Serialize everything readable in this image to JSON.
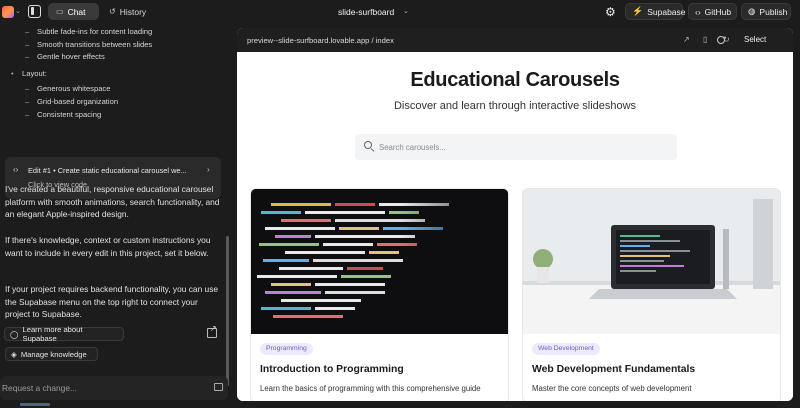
{
  "topbar": {
    "tabs": [
      {
        "label": "Chat",
        "active": true
      },
      {
        "label": "History",
        "active": false
      }
    ],
    "project_title": "slide-surfboard",
    "buttons": {
      "supabase": "Supabase",
      "github": "GitHub",
      "publish": "Publish"
    }
  },
  "chat": {
    "bullets": {
      "sub1": "Subtle fade-ins for content loading",
      "sub2": "Smooth transitions between slides",
      "sub3": "Gentle hover effects",
      "layout": "Layout:",
      "layout1": "Generous whitespace",
      "layout2": "Grid-based organization",
      "layout3": "Consistent spacing"
    },
    "edit_card": {
      "title": "Edit #1 • Create static educational carousel we...",
      "subtitle": "Click to view code"
    },
    "messages": [
      "I've created a beautiful, responsive educational carousel platform with smooth animations, search functionality, and an elegant Apple-inspired design.",
      "If there's knowledge, context or custom instructions you want to include in every edit in this project, set it below.",
      "If your project requires backend functionality, you can use the Supabase menu on the top right to connect your project to Supabase."
    ],
    "learn_button": "Learn more about Supabase",
    "knowledge_button": "Manage knowledge",
    "input_placeholder": "Request a change..."
  },
  "preview": {
    "url": "preview--slide-surfboard.lovable.app / index",
    "select_label": "Select",
    "page": {
      "title": "Educational Carousels",
      "subtitle": "Discover and learn through interactive slideshows",
      "search_placeholder": "Search carousels...",
      "cards": [
        {
          "tag": "Programming",
          "title": "Introduction to Programming",
          "description": "Learn the basics of programming with this comprehensive guide",
          "tag_color": "#6d5bd0",
          "tag_bg": "#eeeafc"
        },
        {
          "tag": "Web Development",
          "title": "Web Development Fundamentals",
          "description": "Master the core concepts of web development",
          "tag_color": "#6d5bd0",
          "tag_bg": "#eeeafc"
        }
      ]
    }
  }
}
